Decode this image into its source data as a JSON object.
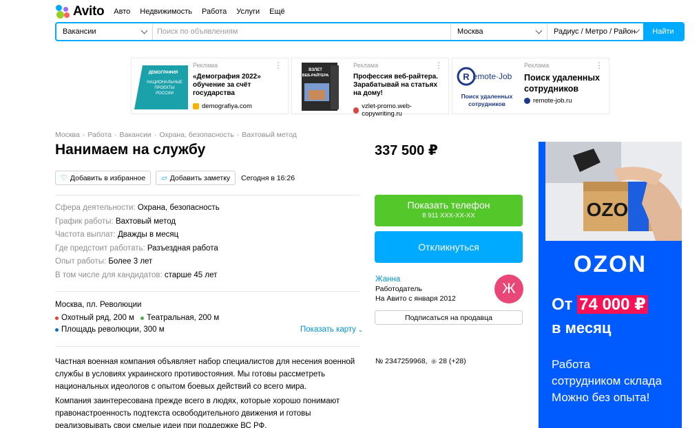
{
  "header": {
    "logo_text": "Avito",
    "nav": [
      "Авто",
      "Недвижимость",
      "Работа",
      "Услуги",
      "Ещё"
    ]
  },
  "search": {
    "category": "Вакансии",
    "placeholder": "Поиск по объявлениям",
    "city": "Москва",
    "radius": "Радиус / Метро / Район",
    "submit": "Найти"
  },
  "ads": [
    {
      "label": "Реклама",
      "title": "«Демография 2022» обучение за счёт государства",
      "domain": "demografiya.com",
      "fav_color": "#f5b400",
      "img_text": "ДЕМОГРАФИЯ НАЦИОНАЛЬНЫЕ ПРОЕКТЫ РОССИИ"
    },
    {
      "label": "Реклама",
      "title": "Профессия веб-райтера. Зарабатывай на статьях на дому!",
      "domain": "vzlet-promo.web-copywriting.ru",
      "fav_color": "#d44",
      "img_text": "ВЗЛЕТ ВЕБ-РАЙТЕРА"
    },
    {
      "label": "Реклама",
      "title": "Поиск удаленных сотрудников",
      "domain": "remote-job.ru",
      "fav_color": "#1d3a8a",
      "img_brand": "Remote-Job",
      "img_text": "Поиск удаленных сотрудников"
    }
  ],
  "breadcrumbs": [
    "Москва",
    "Работа",
    "Вакансии",
    "Охрана, безопасность",
    "Вахтовый метод"
  ],
  "listing": {
    "title": "Нанимаем на службу",
    "price": "337 500 ₽",
    "fav_button": "Добавить в избранное",
    "note_button": "Добавить заметку",
    "date": "Сегодня в 16:26"
  },
  "params": [
    {
      "k": "Сфера деятельности:",
      "v": "Охрана, безопасность"
    },
    {
      "k": "График работы:",
      "v": "Вахтовый метод"
    },
    {
      "k": "Частота выплат:",
      "v": "Дважды в месяц"
    },
    {
      "k": "Где предстоит работать:",
      "v": "Разъездная работа"
    },
    {
      "k": "Опыт работы:",
      "v": "Более 3 лет"
    },
    {
      "k": "В том числе для кандидатов:",
      "v": "старше 45 лет"
    }
  ],
  "address": {
    "text": "Москва, пл. Революции",
    "metro": [
      {
        "name": "Охотный ряд, 200 м",
        "color": "#e4402e"
      },
      {
        "name": "Театральная, 200 м",
        "color": "#4baf4f"
      },
      {
        "name": "Площадь революции, 300 м",
        "color": "#0a6fc2"
      }
    ],
    "show_map": "Показать карту"
  },
  "description": [
    "Частная военная компания объявляет набор специалистов для несения военной службы в условиях украинского противостояния. Мы готовы рассметреть национальных идеологов с опытом боевых действий со всего мира.",
    "Компания заинтересована прежде всего в людях, которые хорошо понимают правонастроенность подтекста освободительного движения и готовы реализовывать свои смелые идеи при поддержке ВС РФ."
  ],
  "contact": {
    "phone_button": "Показать телефон",
    "phone_masked": "8 911 XXX-XX-XX",
    "reply_button": "Откликнуться",
    "seller_name": "Жанна",
    "seller_type": "Работодатель",
    "seller_since": "На Авито с января 2012",
    "avatar_letter": "Ж",
    "subscribe_button": "Подписаться на продавца"
  },
  "meta": {
    "id": "№ 2347259968,",
    "views": "28 (+28)"
  },
  "banner": {
    "brand": "OZON",
    "from": "От",
    "amount": "74 000 ₽",
    "month": "в месяц",
    "sub1": "Работа",
    "sub2": "сотрудником склада",
    "sub3": "Можно без опыта!",
    "box_label": "OZO",
    "bg_color": "#005bff",
    "highlight_color": "#f91155"
  }
}
